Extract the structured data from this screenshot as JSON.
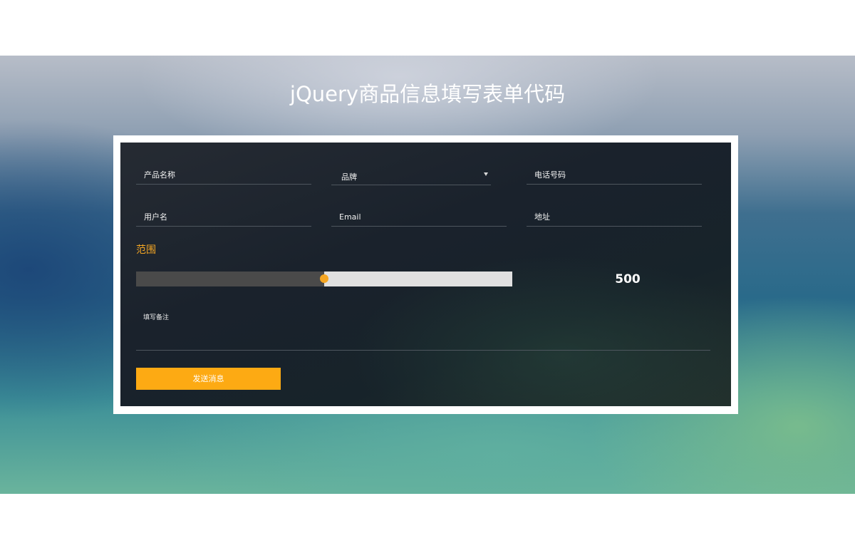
{
  "page": {
    "title": "jQuery商品信息填写表单代码"
  },
  "form": {
    "fields": {
      "product_name": "产品名称",
      "brand": "品牌",
      "phone": "电话号码",
      "username": "用户名",
      "email": "Email",
      "address": "地址"
    },
    "range": {
      "label": "范围",
      "value": "500",
      "fraction": 0.5
    },
    "notes_placeholder": "填写备注",
    "submit_label": "发送消息"
  },
  "colors": {
    "accent": "#f5a623",
    "button": "#fdaa13",
    "panel": "#1e252d"
  },
  "icons": {
    "select_arrow": "caret-down-icon"
  }
}
